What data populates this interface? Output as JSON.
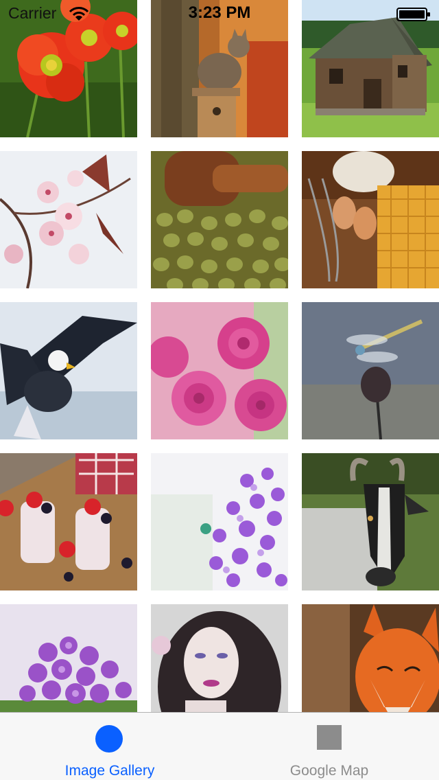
{
  "status_bar": {
    "carrier": "Carrier",
    "time": "3:23 PM"
  },
  "gallery": {
    "images": [
      {
        "subject": "red-poppies"
      },
      {
        "subject": "cat-on-birdhouse"
      },
      {
        "subject": "wooden-barn"
      },
      {
        "subject": "cherry-blossoms"
      },
      {
        "subject": "green-olives"
      },
      {
        "subject": "eggs-and-waffles"
      },
      {
        "subject": "bald-eagle"
      },
      {
        "subject": "pink-roses"
      },
      {
        "subject": "dragonfly-on-thistle"
      },
      {
        "subject": "berry-parfaits"
      },
      {
        "subject": "purple-flowers"
      },
      {
        "subject": "goat"
      },
      {
        "subject": "violet-flowers"
      },
      {
        "subject": "woman-portrait"
      },
      {
        "subject": "red-fox"
      }
    ]
  },
  "tab_bar": {
    "tabs": [
      {
        "label": "Image Gallery",
        "icon": "circle-icon",
        "selected": true
      },
      {
        "label": "Google Map",
        "icon": "square-icon",
        "selected": false
      }
    ],
    "colors": {
      "active": "#0a60ff",
      "inactive": "#8c8c8c"
    }
  }
}
